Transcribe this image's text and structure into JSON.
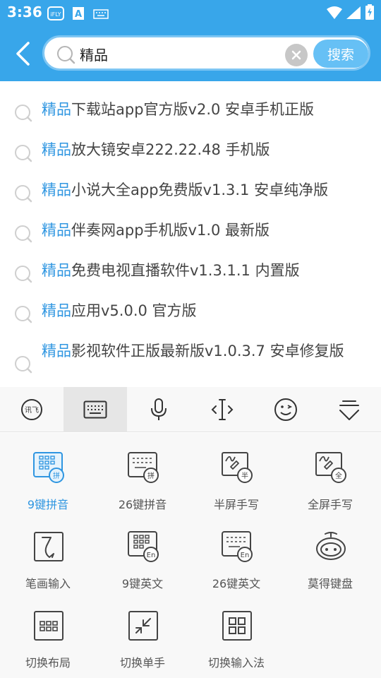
{
  "status_bar": {
    "time": "3:36",
    "icons": [
      "ifly-icon",
      "a-text-icon",
      "keyboard-icon",
      "wifi-icon",
      "signal-icon",
      "battery-charging-icon"
    ]
  },
  "search": {
    "query": "精品",
    "placeholder": "",
    "button_label": "搜索"
  },
  "suggestions": [
    {
      "highlight": "精品",
      "rest": "下载站app官方版v2.0 安卓手机正版"
    },
    {
      "highlight": "精品",
      "rest": "放大镜安卓222.22.48 手机版"
    },
    {
      "highlight": "精品",
      "rest": "小说大全app免费版v1.3.1 安卓纯净版"
    },
    {
      "highlight": "精品",
      "rest": "伴奏网app手机版v1.0 最新版"
    },
    {
      "highlight": "精品",
      "rest": "免费电视直播软件v1.3.1.1 内置版"
    },
    {
      "highlight": "精品",
      "rest": "应用v5.0.0 官方版"
    },
    {
      "highlight": "精品",
      "rest": "影视软件正版最新版v1.0.3.7 安卓修复版"
    }
  ],
  "keyboard_toolbar": {
    "buttons": [
      "ifly-logo-icon",
      "keyboard-icon",
      "microphone-icon",
      "cursor-move-icon",
      "emoji-icon",
      "hide-keyboard-icon"
    ],
    "active_index": 1
  },
  "keyboard_panel": {
    "items": [
      {
        "label": "9键拼音",
        "icon": "t9-pinyin-icon",
        "active": true
      },
      {
        "label": "26键拼音",
        "icon": "qwerty-pinyin-icon",
        "active": false
      },
      {
        "label": "半屏手写",
        "icon": "half-handwriting-icon",
        "active": false
      },
      {
        "label": "全屏手写",
        "icon": "full-handwriting-icon",
        "active": false
      },
      {
        "label": "笔画输入",
        "icon": "stroke-input-icon",
        "active": false
      },
      {
        "label": "9键英文",
        "icon": "t9-english-icon",
        "active": false
      },
      {
        "label": "26键英文",
        "icon": "qwerty-english-icon",
        "active": false
      },
      {
        "label": "莫得键盘",
        "icon": "mode-keyboard-icon",
        "active": false
      },
      {
        "label": "切换布局",
        "icon": "layout-switch-icon",
        "active": false
      },
      {
        "label": "切换单手",
        "icon": "one-hand-icon",
        "active": false
      },
      {
        "label": "切换输入法",
        "icon": "switch-ime-icon",
        "active": false
      }
    ]
  },
  "colors": {
    "header": "#38a6ea",
    "accent": "#2f96e1",
    "search_button": "#66c0f5"
  }
}
